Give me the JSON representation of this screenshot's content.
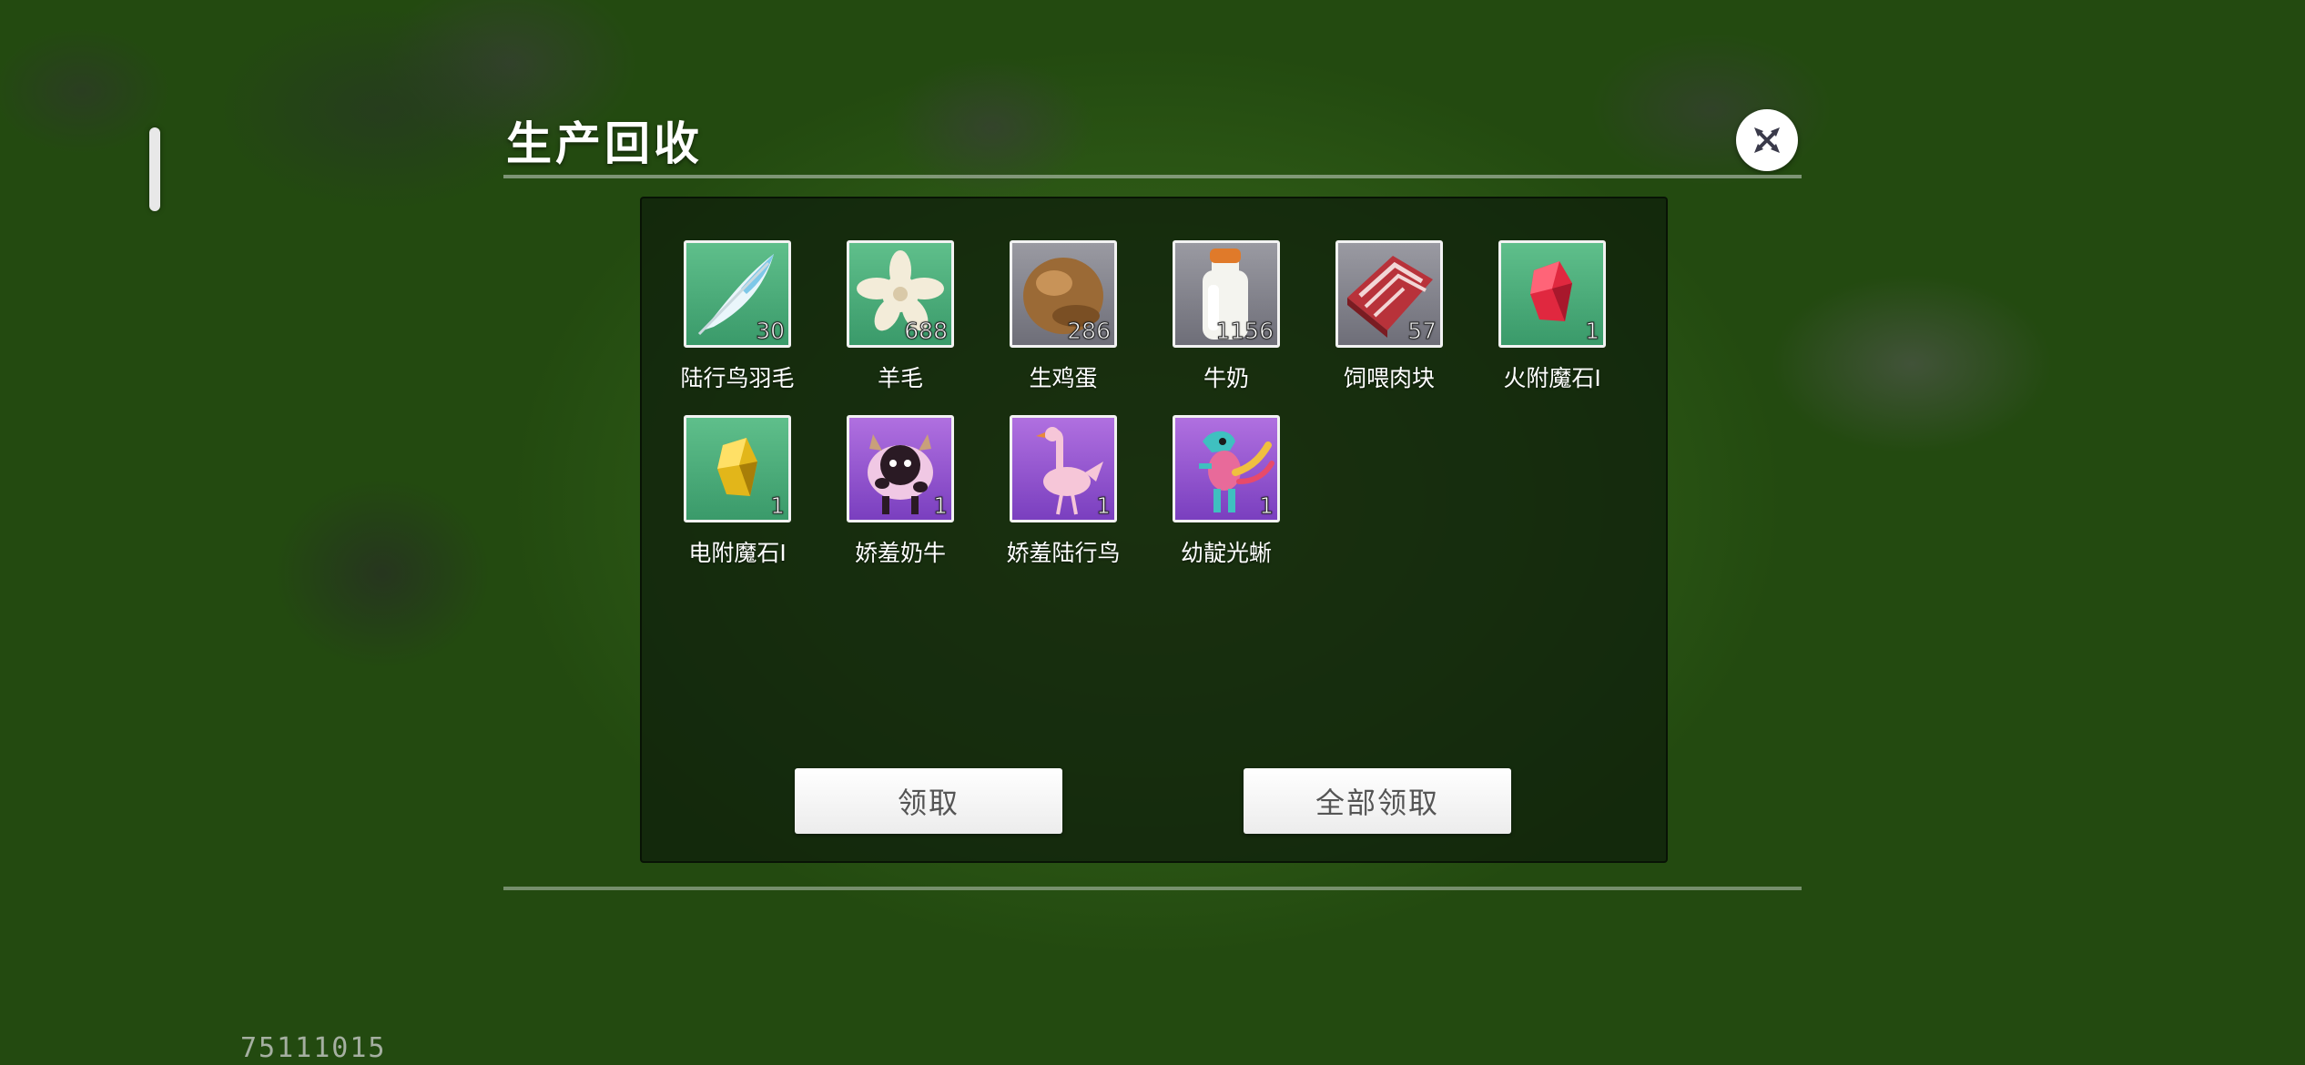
{
  "window": {
    "title": "生产回收"
  },
  "items": [
    {
      "name": "陆行鸟羽毛",
      "count": "30",
      "icon": "feather-icon",
      "bg": "green"
    },
    {
      "name": "羊毛",
      "count": "688",
      "icon": "wool-icon",
      "bg": "green"
    },
    {
      "name": "生鸡蛋",
      "count": "286",
      "icon": "egg-icon",
      "bg": "grey"
    },
    {
      "name": "牛奶",
      "count": "1156",
      "icon": "milk-bottle-icon",
      "bg": "grey"
    },
    {
      "name": "饲喂肉块",
      "count": "57",
      "icon": "meat-icon",
      "bg": "grey"
    },
    {
      "name": "火附魔石Ⅰ",
      "count": "1",
      "icon": "red-crystal-icon",
      "bg": "green"
    },
    {
      "name": "电附魔石Ⅰ",
      "count": "1",
      "icon": "yellow-crystal-icon",
      "bg": "green"
    },
    {
      "name": "娇羞奶牛",
      "count": "1",
      "icon": "cow-icon",
      "bg": "purple"
    },
    {
      "name": "娇羞陆行鸟",
      "count": "1",
      "icon": "chocobo-icon",
      "bg": "purple"
    },
    {
      "name": "幼靛光蜥",
      "count": "1",
      "icon": "lizard-icon",
      "bg": "purple"
    }
  ],
  "buttons": {
    "claim": "领取",
    "claim_all": "全部领取"
  },
  "uid": "75111015",
  "colors": {
    "panel_bg": "#10200c",
    "green_slot": "#4fae7a",
    "purple_slot": "#9a58d0",
    "grey_slot": "#8a8a92"
  }
}
